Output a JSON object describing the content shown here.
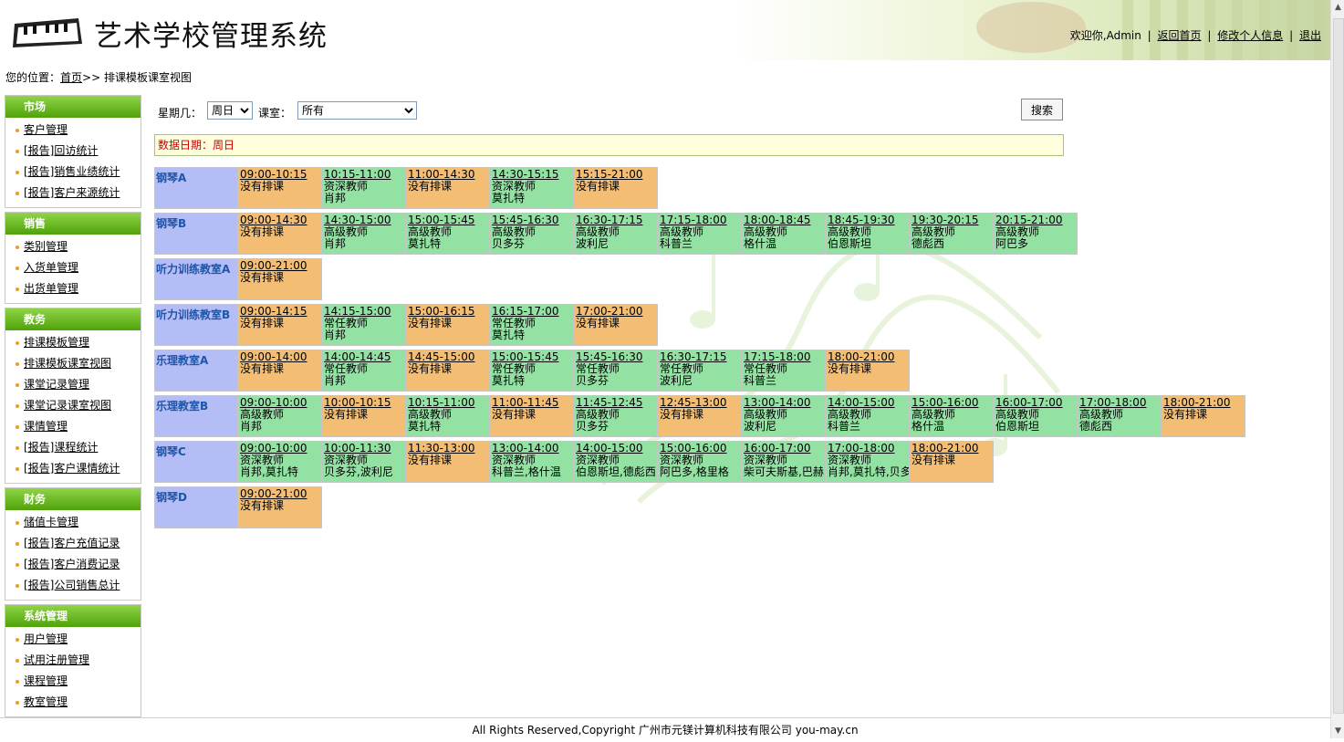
{
  "header": {
    "title": "艺术学校管理系统",
    "welcome": "欢迎你,Admin",
    "links": [
      "返回首页",
      "修改个人信息",
      "退出"
    ]
  },
  "breadcrumb": {
    "prefix": "您的位置：",
    "home": "首页",
    "current": ">> 排课模板课室视图"
  },
  "sidebar": [
    {
      "title": "市场",
      "items": [
        "客户管理",
        "[报告]回访统计",
        "[报告]销售业绩统计",
        "[报告]客户来源统计"
      ]
    },
    {
      "title": "销售",
      "items": [
        "类别管理",
        "入货单管理",
        "出货单管理"
      ]
    },
    {
      "title": "教务",
      "items": [
        "排课模板管理",
        "排课模板课室视图",
        "课堂记录管理",
        "课堂记录课室视图",
        "课情管理",
        "[报告]课程统计",
        "[报告]客户课情统计"
      ]
    },
    {
      "title": "财务",
      "items": [
        "储值卡管理",
        "[报告]客户充值记录",
        "[报告]客户消费记录",
        "[报告]公司销售总计"
      ]
    },
    {
      "title": "系统管理",
      "items": [
        "用户管理",
        "试用注册管理",
        "课程管理",
        "教室管理"
      ]
    }
  ],
  "filter": {
    "day_label": "星期几：",
    "day_value": "周日",
    "room_label": "课室：",
    "room_value": "所有",
    "search_label": "搜索"
  },
  "date_bar": "数据日期：周日",
  "schedule": [
    {
      "room": "钢琴A",
      "slots": [
        {
          "time": "09:00-10:15",
          "status": "没有排课",
          "free": true
        },
        {
          "time": "10:15-11:00",
          "teacher": "资深教师",
          "student": "肖邦"
        },
        {
          "time": "11:00-14:30",
          "status": "没有排课",
          "free": true
        },
        {
          "time": "14:30-15:15",
          "teacher": "资深教师",
          "student": "莫扎特"
        },
        {
          "time": "15:15-21:00",
          "status": "没有排课",
          "free": true
        }
      ]
    },
    {
      "room": "钢琴B",
      "slots": [
        {
          "time": "09:00-14:30",
          "status": "没有排课",
          "free": true
        },
        {
          "time": "14:30-15:00",
          "teacher": "高级教师",
          "student": "肖邦"
        },
        {
          "time": "15:00-15:45",
          "teacher": "高级教师",
          "student": "莫扎特"
        },
        {
          "time": "15:45-16:30",
          "teacher": "高级教师",
          "student": "贝多芬"
        },
        {
          "time": "16:30-17:15",
          "teacher": "高级教师",
          "student": "波利尼"
        },
        {
          "time": "17:15-18:00",
          "teacher": "高级教师",
          "student": "科普兰"
        },
        {
          "time": "18:00-18:45",
          "teacher": "高级教师",
          "student": "格什温"
        },
        {
          "time": "18:45-19:30",
          "teacher": "高级教师",
          "student": "伯恩斯坦"
        },
        {
          "time": "19:30-20:15",
          "teacher": "高级教师",
          "student": "德彪西"
        },
        {
          "time": "20:15-21:00",
          "teacher": "高级教师",
          "student": "阿巴多"
        }
      ]
    },
    {
      "room": "听力训练教室A",
      "slots": [
        {
          "time": "09:00-21:00",
          "status": "没有排课",
          "free": true
        }
      ]
    },
    {
      "room": "听力训练教室B",
      "slots": [
        {
          "time": "09:00-14:15",
          "status": "没有排课",
          "free": true
        },
        {
          "time": "14:15-15:00",
          "teacher": "常任教师",
          "student": "肖邦"
        },
        {
          "time": "15:00-16:15",
          "status": "没有排课",
          "free": true
        },
        {
          "time": "16:15-17:00",
          "teacher": "常任教师",
          "student": "莫扎特"
        },
        {
          "time": "17:00-21:00",
          "status": "没有排课",
          "free": true
        }
      ]
    },
    {
      "room": "乐理教室A",
      "slots": [
        {
          "time": "09:00-14:00",
          "status": "没有排课",
          "free": true
        },
        {
          "time": "14:00-14:45",
          "teacher": "常任教师",
          "student": "肖邦"
        },
        {
          "time": "14:45-15:00",
          "status": "没有排课",
          "free": true
        },
        {
          "time": "15:00-15:45",
          "teacher": "常任教师",
          "student": "莫扎特"
        },
        {
          "time": "15:45-16:30",
          "teacher": "常任教师",
          "student": "贝多芬"
        },
        {
          "time": "16:30-17:15",
          "teacher": "常任教师",
          "student": "波利尼"
        },
        {
          "time": "17:15-18:00",
          "teacher": "常任教师",
          "student": "科普兰"
        },
        {
          "time": "18:00-21:00",
          "status": "没有排课",
          "free": true
        }
      ]
    },
    {
      "room": "乐理教室B",
      "slots": [
        {
          "time": "09:00-10:00",
          "teacher": "高级教师",
          "student": "肖邦"
        },
        {
          "time": "10:00-10:15",
          "status": "没有排课",
          "free": true
        },
        {
          "time": "10:15-11:00",
          "teacher": "高级教师",
          "student": "莫扎特"
        },
        {
          "time": "11:00-11:45",
          "status": "没有排课",
          "free": true
        },
        {
          "time": "11:45-12:45",
          "teacher": "高级教师",
          "student": "贝多芬"
        },
        {
          "time": "12:45-13:00",
          "status": "没有排课",
          "free": true
        },
        {
          "time": "13:00-14:00",
          "teacher": "高级教师",
          "student": "波利尼"
        },
        {
          "time": "14:00-15:00",
          "teacher": "高级教师",
          "student": "科普兰"
        },
        {
          "time": "15:00-16:00",
          "teacher": "高级教师",
          "student": "格什温"
        },
        {
          "time": "16:00-17:00",
          "teacher": "高级教师",
          "student": "伯恩斯坦"
        },
        {
          "time": "17:00-18:00",
          "teacher": "高级教师",
          "student": "德彪西"
        },
        {
          "time": "18:00-21:00",
          "status": "没有排课",
          "free": true
        }
      ]
    },
    {
      "room": "钢琴C",
      "slots": [
        {
          "time": "09:00-10:00",
          "teacher": "资深教师",
          "student": "肖邦,莫扎特"
        },
        {
          "time": "10:00-11:30",
          "teacher": "资深教师",
          "student": "贝多芬,波利尼"
        },
        {
          "time": "11:30-13:00",
          "status": "没有排课",
          "free": true
        },
        {
          "time": "13:00-14:00",
          "teacher": "资深教师",
          "student": "科普兰,格什温"
        },
        {
          "time": "14:00-15:00",
          "teacher": "资深教师",
          "student": "伯恩斯坦,德彪西"
        },
        {
          "time": "15:00-16:00",
          "teacher": "资深教师",
          "student": "阿巴多,格里格"
        },
        {
          "time": "16:00-17:00",
          "teacher": "资深教师",
          "student": "柴可夫斯基,巴赫"
        },
        {
          "time": "17:00-18:00",
          "teacher": "资深教师",
          "student": "肖邦,莫扎特,贝多"
        },
        {
          "time": "18:00-21:00",
          "status": "没有排课",
          "free": true
        }
      ]
    },
    {
      "room": "钢琴D",
      "slots": [
        {
          "time": "09:00-21:00",
          "status": "没有排课",
          "free": true
        }
      ]
    }
  ],
  "footer": "All Rights Reserved,Copyright 广州市元镁计算机科技有限公司  you-may.cn",
  "colors": {
    "free": "#f3be73",
    "busy": "#93e2a4",
    "room": "#b4bdf5",
    "menu_head": "#5aab12"
  }
}
